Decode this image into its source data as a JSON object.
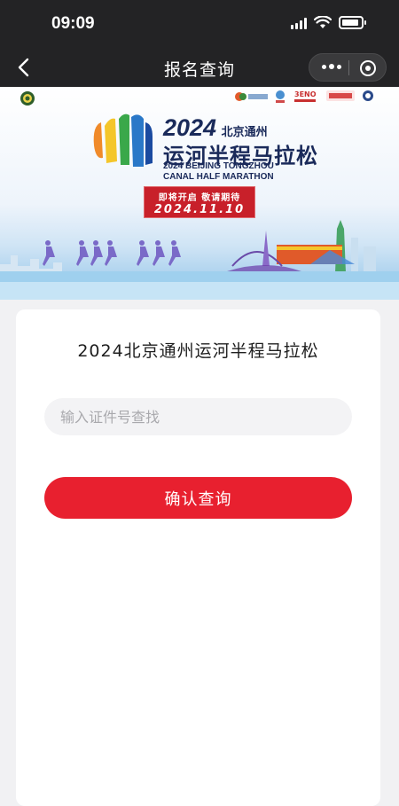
{
  "status_bar": {
    "time": "09:09"
  },
  "nav": {
    "title": "报名查询"
  },
  "banner": {
    "year": "2024",
    "city": "北京通州",
    "title": "运河半程马拉松",
    "subtitle_en_line1": "2024 BEIJING TONGZHOU",
    "subtitle_en_line2": "CANAL HALF MARATHON",
    "tag_line1": "即将开启 敬请期待",
    "tag_date": "2024.11.10",
    "sponsor_brand": "3ENO"
  },
  "card": {
    "title": "2024北京通州运河半程马拉松",
    "search_placeholder": "输入证件号查找",
    "confirm_label": "确认查询"
  }
}
